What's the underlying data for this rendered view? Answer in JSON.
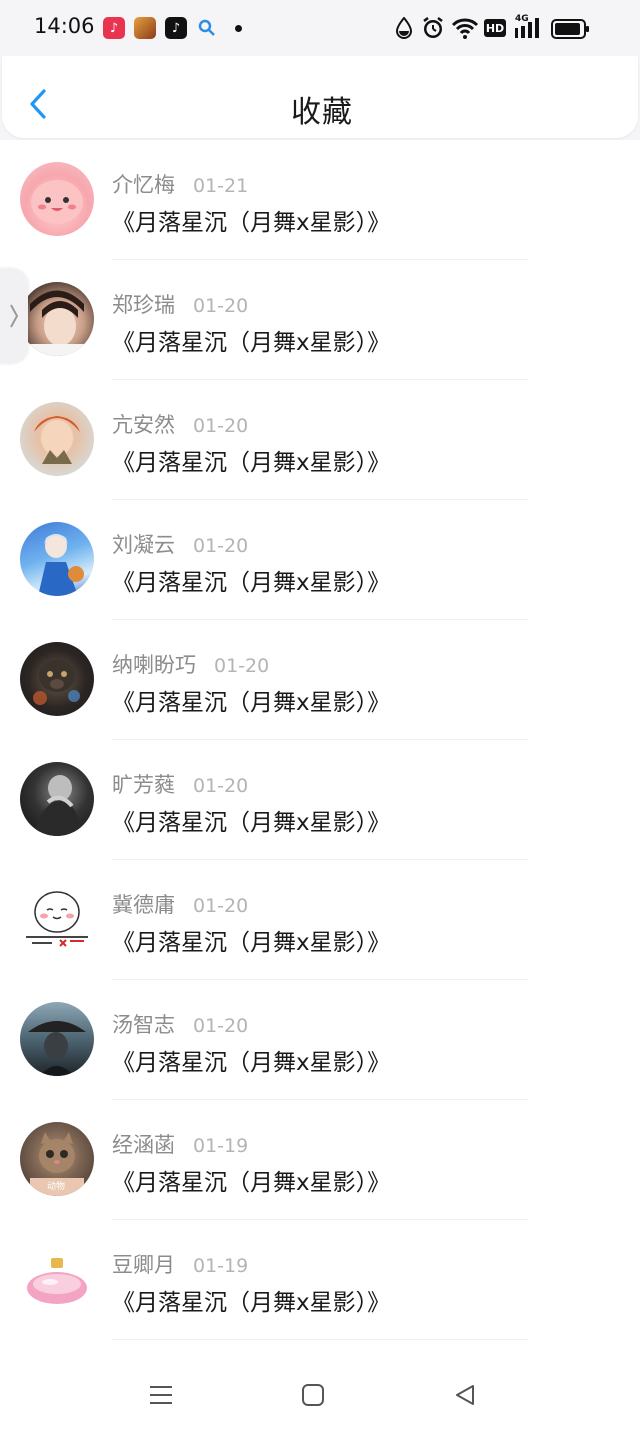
{
  "status_bar": {
    "time": "14:06",
    "network_label": "4G",
    "hd_label": "HD",
    "icons": [
      "music-app-icon",
      "game-app-icon",
      "tiktok-app-icon",
      "search-app-icon",
      "water-drop-icon",
      "alarm-icon",
      "wifi-icon",
      "hd-icon",
      "signal-icon",
      "battery-icon"
    ]
  },
  "header": {
    "title": "收藏",
    "back_icon": "chevron-left-icon",
    "accent_color": "#2196f3"
  },
  "favorites": [
    {
      "name": "介忆梅",
      "date": "01-21",
      "title": "《月落星沉（月舞x星影）》"
    },
    {
      "name": "郑珍瑞",
      "date": "01-20",
      "title": "《月落星沉（月舞x星影）》"
    },
    {
      "name": "亢安然",
      "date": "01-20",
      "title": "《月落星沉（月舞x星影）》"
    },
    {
      "name": "刘凝云",
      "date": "01-20",
      "title": "《月落星沉（月舞x星影）》"
    },
    {
      "name": "纳喇盼巧",
      "date": "01-20",
      "title": "《月落星沉（月舞x星影）》"
    },
    {
      "name": "旷芳蕤",
      "date": "01-20",
      "title": "《月落星沉（月舞x星影）》"
    },
    {
      "name": "冀德庸",
      "date": "01-20",
      "title": "《月落星沉（月舞x星影）》"
    },
    {
      "name": "汤智志",
      "date": "01-20",
      "title": "《月落星沉（月舞x星影）》"
    },
    {
      "name": "经涵菡",
      "date": "01-19",
      "title": "《月落星沉（月舞x星影）》"
    },
    {
      "name": "豆卿月",
      "date": "01-19",
      "title": "《月落星沉（月舞x星影）》"
    }
  ],
  "nav_bar": {
    "icons": [
      "menu-icon",
      "home-icon",
      "back-triangle-icon"
    ]
  }
}
